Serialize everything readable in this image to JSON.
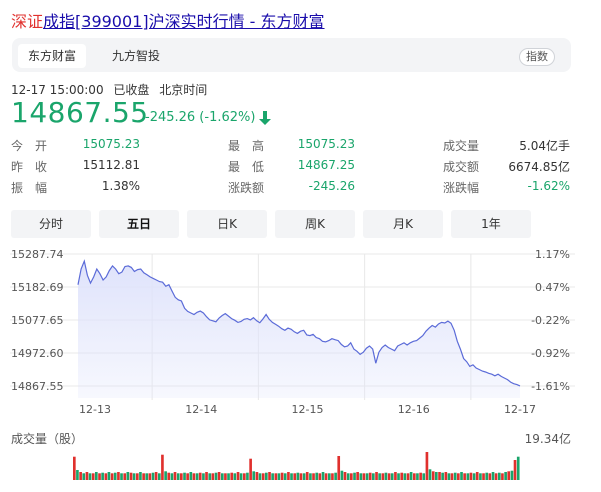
{
  "title": {
    "prefix": "深证",
    "link_text": "成指[399001]沪深实时行情 - 东方财富"
  },
  "tabs": [
    {
      "label": "东方财富",
      "active": true
    },
    {
      "label": "九方智投",
      "active": false
    }
  ],
  "index_badge": "指数",
  "status": {
    "datetime": "12-17 15:00:00",
    "state": "已收盘",
    "timezone": "北京时间"
  },
  "quote": {
    "price": "14867.55",
    "change": "-245.26 (-1.62%)",
    "direction": "down",
    "color": "#1aa56b"
  },
  "stats": {
    "col1": [
      {
        "label": "今　开",
        "value": "15075.23",
        "color": "green"
      },
      {
        "label": "昨　收",
        "value": "15112.81",
        "color": "normal"
      },
      {
        "label": "振　幅",
        "value": "1.38%",
        "color": "normal"
      }
    ],
    "col2": [
      {
        "label": "最　高",
        "value": "15075.23",
        "color": "green"
      },
      {
        "label": "最　低",
        "value": "14867.25",
        "color": "green"
      },
      {
        "label": "涨跌额",
        "value": "-245.26",
        "color": "green"
      }
    ],
    "col3": [
      {
        "label": "成交量",
        "value": "5.04亿手",
        "color": "normal"
      },
      {
        "label": "成交额",
        "value": "6674.85亿",
        "color": "normal"
      },
      {
        "label": "涨跌幅",
        "value": "-1.62%",
        "color": "green"
      }
    ]
  },
  "periods": [
    {
      "label": "分时",
      "active": false
    },
    {
      "label": "五日",
      "active": true
    },
    {
      "label": "日K",
      "active": false
    },
    {
      "label": "周K",
      "active": false
    },
    {
      "label": "月K",
      "active": false
    },
    {
      "label": "1年",
      "active": false
    }
  ],
  "volume": {
    "label": "成交量（股）",
    "max": "19.34亿"
  },
  "chart_data": {
    "type": "line",
    "ylim": [
      14867.55,
      15287.74
    ],
    "y_ticks": [
      "15287.74",
      "15182.69",
      "15077.65",
      "14972.60",
      "14867.55"
    ],
    "pct_ticks": [
      "1.17%",
      "0.47%",
      "-0.22%",
      "-0.92%",
      "-1.61%"
    ],
    "x_ticks": [
      "12-13",
      "12-14",
      "12-15",
      "12-16",
      "12-17"
    ],
    "series": [
      {
        "values": [
          15190,
          15240,
          15265,
          15220,
          15195,
          15215,
          15240,
          15225,
          15205,
          15215,
          15235,
          15250,
          15240,
          15225,
          15230,
          15248,
          15250,
          15245,
          15232,
          15238,
          15240,
          15228,
          15222,
          15215,
          15210,
          15205,
          15200,
          15198,
          15185,
          15190,
          15170,
          15150,
          15142,
          15138,
          15115,
          15105,
          15100,
          15095,
          15102,
          15106,
          15100,
          15088,
          15078,
          15075,
          15072,
          15084,
          15092,
          15098,
          15090,
          15082,
          15077,
          15070,
          15073,
          15080,
          15082,
          15078,
          15085,
          15075,
          15069,
          15081,
          15095,
          15080,
          15070,
          15064,
          15058,
          15050,
          15045,
          15052,
          15048,
          15040,
          15035,
          15042,
          15045,
          15030,
          15028,
          15032,
          15022,
          15018,
          15010,
          15008,
          15012,
          15018,
          15015,
          15012,
          15000,
          14992,
          14995,
          15005,
          14985,
          14978,
          14968,
          14975,
          14988,
          14995,
          14985,
          14940,
          14975,
          14990,
          14998,
          14990,
          14985,
          14980,
          14995,
          15000,
          15005,
          14998,
          15005,
          15010,
          15012,
          15020,
          15028,
          15042,
          15052,
          15060,
          15055,
          15065,
          15070,
          15068,
          15074,
          15067,
          15045,
          15010,
          14985,
          14955,
          14945,
          14930,
          14935,
          14925,
          14920,
          14915,
          14912,
          14908,
          14905,
          14900,
          14905,
          14898,
          14893,
          14888,
          14880,
          14875,
          14872,
          14868
        ]
      }
    ],
    "volume_values": [
      0.35,
      0.15,
      0.12,
      0.1,
      0.12,
      0.1,
      0.1,
      0.12,
      0.1,
      0.11,
      0.1,
      0.12,
      0.1,
      0.11,
      0.12,
      0.1,
      0.1,
      0.12,
      0.11,
      0.1,
      0.1,
      0.12,
      0.1,
      0.1,
      0.1,
      0.11,
      0.12,
      0.1,
      0.38,
      0.13,
      0.11,
      0.1,
      0.12,
      0.1,
      0.1,
      0.11,
      0.1,
      0.12,
      0.1,
      0.1,
      0.11,
      0.1,
      0.12,
      0.1,
      0.1,
      0.11,
      0.12,
      0.1,
      0.1,
      0.1,
      0.11,
      0.1,
      0.12,
      0.1,
      0.1,
      0.11,
      0.32,
      0.13,
      0.12,
      0.1,
      0.1,
      0.11,
      0.12,
      0.1,
      0.1,
      0.1,
      0.11,
      0.1,
      0.12,
      0.1,
      0.1,
      0.11,
      0.1,
      0.1,
      0.12,
      0.1,
      0.1,
      0.11,
      0.1,
      0.12,
      0.1,
      0.1,
      0.1,
      0.11,
      0.36,
      0.14,
      0.12,
      0.1,
      0.1,
      0.11,
      0.12,
      0.1,
      0.1,
      0.1,
      0.11,
      0.1,
      0.12,
      0.1,
      0.1,
      0.11,
      0.1,
      0.1,
      0.12,
      0.1,
      0.11,
      0.1,
      0.1,
      0.12,
      0.1,
      0.1,
      0.11,
      0.1,
      0.42,
      0.16,
      0.13,
      0.12,
      0.12,
      0.11,
      0.12,
      0.1,
      0.1,
      0.11,
      0.1,
      0.12,
      0.1,
      0.1,
      0.11,
      0.1,
      0.12,
      0.1,
      0.1,
      0.11,
      0.1,
      0.12,
      0.1,
      0.11,
      0.1,
      0.12,
      0.13,
      0.14,
      0.3,
      0.35
    ],
    "colors": {
      "line": "#5b6bd8",
      "fill": "#dfe3fb",
      "up": "#e0302d",
      "down": "#1aa56b",
      "grid": "#e8e8e8"
    }
  }
}
